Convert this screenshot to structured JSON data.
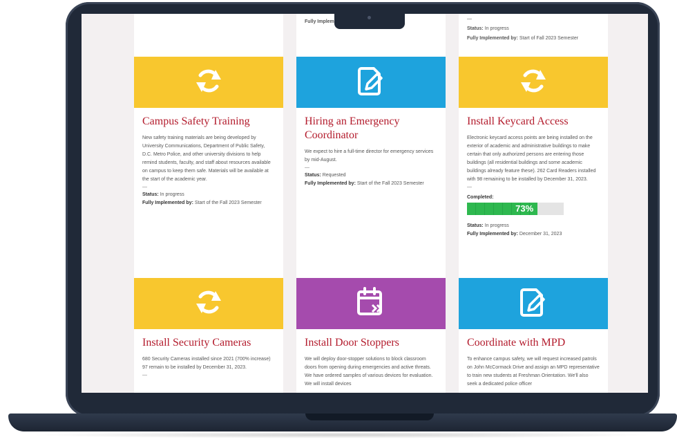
{
  "cards": [
    {
      "title": "Campus Safety Training",
      "icon": "refresh-icon",
      "color": "#f8c72e",
      "body": "New safety training materials are being developed by University Communications, Department of Public Safety, D.C. Metro Police, and other university divisions to help remind students, faculty, and staff about resources available on campus to keep them safe. Materials will be available at the start of the academic year.",
      "status_label": "Status:",
      "status": "In progress",
      "impl_label": "Fully Implemented by:",
      "impl": "Start of the Fall 2023 Semester"
    },
    {
      "title": "Hiring an Emergency Coordinator",
      "icon": "document-edit-icon",
      "color": "#1ea3dd",
      "body": "We expect to hire a full-time director for emergency services by mid-August.",
      "status_label": "Status:",
      "status": "Requested",
      "impl_label": "Fully Implemented by:",
      "impl": "Start of the Fall 2023 Semester"
    },
    {
      "title": "Install Keycard Access",
      "icon": "refresh-icon",
      "color": "#f8c72e",
      "body": "Electronic keycard access points are being installed on the exterior of academic and administrative buildings to make certain that only authorized persons are entering those buildings (all residential buildings and some academic buildings already feature these). 262 Card Readers installed with 98 remaining to be installed by December 31, 2023.",
      "progress_label": "Completed:",
      "progress_text": "73%",
      "progress_value": 73,
      "status_label": "Status:",
      "status": "In progress",
      "impl_label": "Fully Implemented by:",
      "impl": "December 31, 2023"
    },
    {
      "title": "Install Security Cameras",
      "icon": "refresh-icon",
      "color": "#f8c72e",
      "body": "680 Security Cameras installed since 2021 (700% increase) 97 remain to be installed by December 31, 2023."
    },
    {
      "title": "Install Door Stoppers",
      "icon": "calendar-forward-icon",
      "color": "#a54bad",
      "body": "We will deploy door-stopper solutions to block classroom doors from opening during emergencies and active threats. We have ordered samples of various devices for evaluation. We will install devices"
    },
    {
      "title": "Coordinate with MPD",
      "icon": "document-edit-icon",
      "color": "#1ea3dd",
      "body": "To enhance campus safety, we will request increased patrols on John McCormack Drive and assign an MPD representative to train new students at Freshman Orientation. We'll also seek a dedicated police officer"
    }
  ],
  "top": {
    "col2_impl_label": "Fully Implem",
    "col3_dash": "—",
    "col3_status_label": "Status:",
    "col3_status": "In progress",
    "col3_impl_label": "Fully Implemented by:",
    "col3_impl": "Start of Fall 2023 Semester"
  },
  "dash": "—"
}
